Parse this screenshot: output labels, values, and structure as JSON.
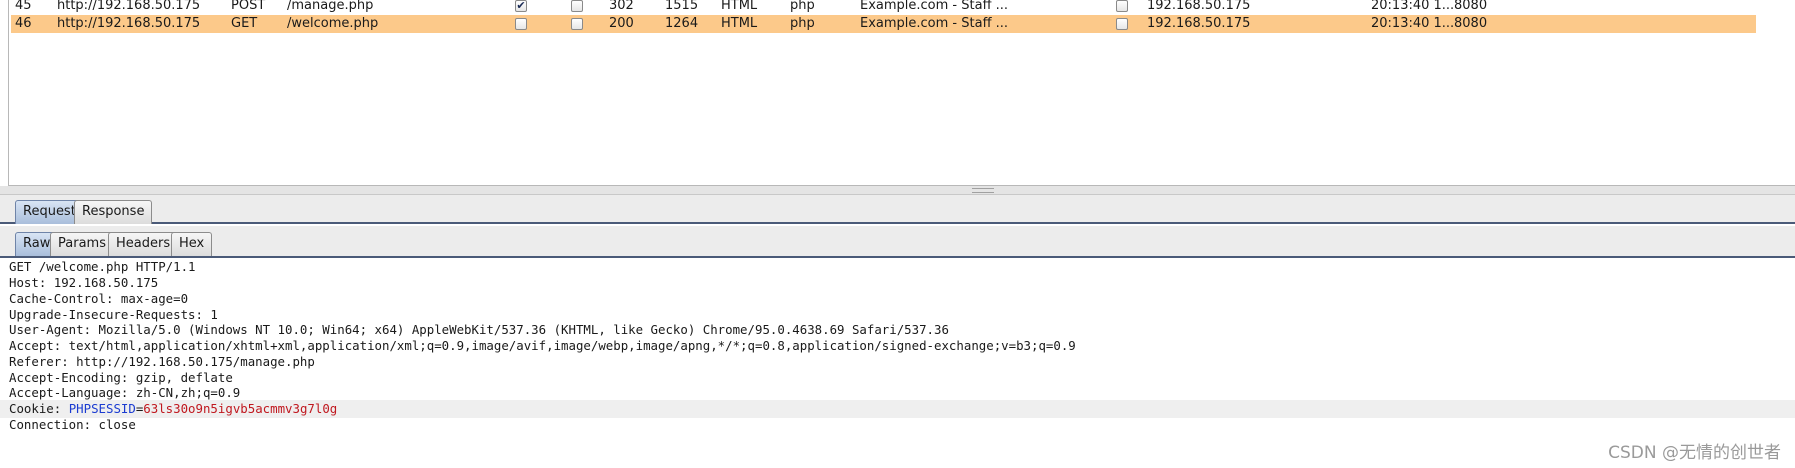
{
  "history": {
    "rows": [
      {
        "num": "45",
        "host": "http://192.168.50.175",
        "method": "POST",
        "url": "/manage.php",
        "params_checked": true,
        "edited_checked": false,
        "status": "302",
        "length": "1515",
        "mime": "HTML",
        "ext": "php",
        "title": "Example.com - Staff ...",
        "ssl_checked": false,
        "ip": "192.168.50.175",
        "time": "20:13:40 1...",
        "port": "8080",
        "selected": false
      },
      {
        "num": "46",
        "host": "http://192.168.50.175",
        "method": "GET",
        "url": "/welcome.php",
        "params_checked": false,
        "edited_checked": false,
        "status": "200",
        "length": "1264",
        "mime": "HTML",
        "ext": "php",
        "title": "Example.com - Staff ...",
        "ssl_checked": false,
        "ip": "192.168.50.175",
        "time": "20:13:40 1...",
        "port": "8080",
        "selected": true
      }
    ]
  },
  "message_tabs": {
    "request": "Request",
    "response": "Response",
    "active": "request"
  },
  "view_tabs": {
    "raw": "Raw",
    "params": "Params",
    "headers": "Headers",
    "hex": "Hex",
    "active": "raw"
  },
  "raw_request": {
    "lines": [
      "GET /welcome.php HTTP/1.1",
      "Host: 192.168.50.175",
      "Cache-Control: max-age=0",
      "Upgrade-Insecure-Requests: 1",
      "User-Agent: Mozilla/5.0 (Windows NT 10.0; Win64; x64) AppleWebKit/537.36 (KHTML, like Gecko) Chrome/95.0.4638.69 Safari/537.36",
      "Accept: text/html,application/xhtml+xml,application/xml;q=0.9,image/avif,image/webp,image/apng,*/*;q=0.8,application/signed-exchange;v=b3;q=0.9",
      "Referer: http://192.168.50.175/manage.php",
      "Accept-Encoding: gzip, deflate",
      "Accept-Language: zh-CN,zh;q=0.9"
    ],
    "cookie": {
      "prefix": "Cookie: ",
      "name": "PHPSESSID",
      "eq": "=",
      "value": "63ls30o9n5igvb5acmmv3g7l0g"
    },
    "after_cookie": [
      "Connection: close"
    ]
  },
  "watermark": "CSDN @无情的创世者",
  "colors": {
    "selected_row": "#fcc98a",
    "active_tab": "#a9bedb",
    "cookie_name": "#1a3bd1",
    "cookie_value": "#c0181f"
  }
}
